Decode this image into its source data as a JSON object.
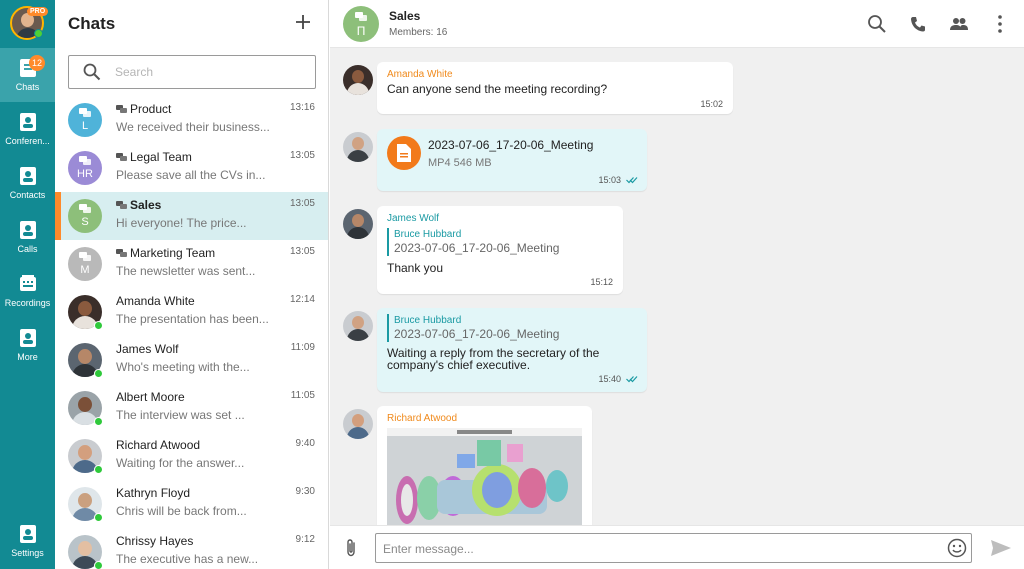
{
  "rail": {
    "pro_badge": "PRO",
    "chats_badge": "12",
    "items": [
      {
        "label": "Chats"
      },
      {
        "label": "Conferen..."
      },
      {
        "label": "Contacts"
      },
      {
        "label": "Calls"
      },
      {
        "label": "Recordings"
      },
      {
        "label": "More"
      }
    ],
    "settings_label": "Settings"
  },
  "list": {
    "title": "Chats",
    "search_placeholder": "Search",
    "chats": [
      {
        "name": "Product",
        "time": "13:16",
        "preview": "We received their business...",
        "initials": "L",
        "avatar_color": "#4fb3d9",
        "group": true
      },
      {
        "name": "Legal Team",
        "time": "13:05",
        "preview": "Please save all the CVs in...",
        "initials": "HR",
        "avatar_color": "#9b8bd6",
        "group": true
      },
      {
        "name": "Sales",
        "time": "13:05",
        "preview": "Hi everyone! The price...",
        "initials": "S",
        "avatar_color": "#8dbf7a",
        "group": true
      },
      {
        "name": "Marketing Team",
        "time": "13:05",
        "preview": "The newsletter was sent...",
        "initials": "M",
        "avatar_color": "#b9b9b9",
        "group": true
      },
      {
        "name": "Amanda White",
        "time": "12:14",
        "preview": "The presentation has been...",
        "group": false
      },
      {
        "name": "James Wolf",
        "time": "11:09",
        "preview": "Who's meeting with the...",
        "group": false
      },
      {
        "name": "Albert Moore",
        "time": "11:05",
        "preview": "The interview was set ...",
        "group": false
      },
      {
        "name": "Richard Atwood",
        "time": "9:40",
        "preview": "Waiting for the answer...",
        "group": false
      },
      {
        "name": "Kathryn Floyd",
        "time": "9:30",
        "preview": "Chris will be back from...",
        "group": false
      },
      {
        "name": "Chrissy Hayes",
        "time": "9:12",
        "preview": "The executive has a new...",
        "group": false
      }
    ]
  },
  "conversation": {
    "title": "Sales",
    "subtitle": "Members: 16",
    "avatar_initial": "П",
    "messages": [
      {
        "sender": "Amanda White",
        "sender_color": "#f08a1c",
        "text": "Can anyone send the meeting recording?",
        "time": "15:02"
      },
      {
        "file_name": "2023-07-06_17-20-06_Meeting",
        "file_meta": "MP4 546 MB",
        "time": "15:03"
      },
      {
        "sender": "James Wolf",
        "sender_color": "#1a9aa3",
        "quote_name": "Bruce Hubbard",
        "quote_text": "2023-07-06_17-20-06_Meeting",
        "text": "Thank you",
        "time": "15:12"
      },
      {
        "quote_name": "Bruce Hubbard",
        "quote_text": "2023-07-06_17-20-06_Meeting",
        "text_line1": "Waiting a reply from the secretary of the",
        "text_line2": "company's chief executive.",
        "time": "15:40"
      },
      {
        "sender": "Richard Atwood",
        "sender_color": "#f08a1c"
      }
    ]
  },
  "composer": {
    "placeholder": "Enter message..."
  },
  "colors": {
    "rail": "#128a93",
    "accent_orange": "#ff8a2a",
    "selected_row": "#d7eef0",
    "own_bubble": "#e2f6f8"
  }
}
